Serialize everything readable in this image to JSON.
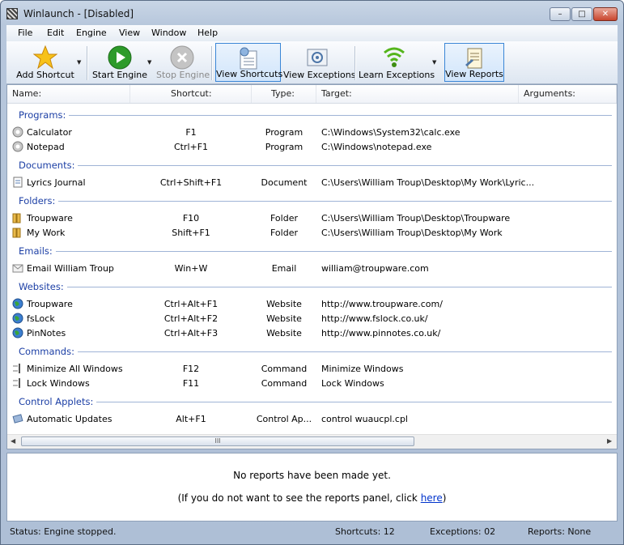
{
  "window": {
    "title": "Winlaunch - [Disabled]",
    "min_label": "–",
    "max_label": "□",
    "close_label": "✕"
  },
  "menu": [
    "File",
    "Edit",
    "Engine",
    "View",
    "Window",
    "Help"
  ],
  "toolbar": {
    "add_shortcut": "Add Shortcut",
    "start_engine": "Start Engine",
    "stop_engine": "Stop Engine",
    "view_shortcuts": "View Shortcuts",
    "view_exceptions": "View Exceptions",
    "learn_exceptions": "Learn Exceptions",
    "view_reports": "View Reports",
    "dropdown_glyph": "▼"
  },
  "columns": {
    "name": "Name:",
    "shortcut": "Shortcut:",
    "type": "Type:",
    "target": "Target:",
    "arguments": "Arguments:"
  },
  "groups": [
    {
      "name": "Programs:",
      "items": [
        {
          "icon": "calculator-icon",
          "name": "Calculator",
          "shortcut": "F1",
          "type": "Program",
          "target": "C:\\Windows\\System32\\calc.exe"
        },
        {
          "icon": "notepad-icon",
          "name": "Notepad",
          "shortcut": "Ctrl+F1",
          "type": "Program",
          "target": "C:\\Windows\\notepad.exe"
        }
      ]
    },
    {
      "name": "Documents:",
      "items": [
        {
          "icon": "document-icon",
          "name": "Lyrics Journal",
          "shortcut": "Ctrl+Shift+F1",
          "type": "Document",
          "target": "C:\\Users\\William Troup\\Desktop\\My Work\\Lyric..."
        }
      ]
    },
    {
      "name": "Folders:",
      "items": [
        {
          "icon": "folder-icon",
          "name": "Troupware",
          "shortcut": "F10",
          "type": "Folder",
          "target": "C:\\Users\\William Troup\\Desktop\\Troupware"
        },
        {
          "icon": "folder-icon",
          "name": "My Work",
          "shortcut": "Shift+F1",
          "type": "Folder",
          "target": "C:\\Users\\William Troup\\Desktop\\My Work"
        }
      ]
    },
    {
      "name": "Emails:",
      "items": [
        {
          "icon": "email-icon",
          "name": "Email William Troup",
          "shortcut": "Win+W",
          "type": "Email",
          "target": "william@troupware.com"
        }
      ]
    },
    {
      "name": "Websites:",
      "items": [
        {
          "icon": "globe-icon",
          "name": "Troupware",
          "shortcut": "Ctrl+Alt+F1",
          "type": "Website",
          "target": "http://www.troupware.com/"
        },
        {
          "icon": "globe-icon",
          "name": "fsLock",
          "shortcut": "Ctrl+Alt+F2",
          "type": "Website",
          "target": "http://www.fslock.co.uk/"
        },
        {
          "icon": "globe-icon",
          "name": "PinNotes",
          "shortcut": "Ctrl+Alt+F3",
          "type": "Website",
          "target": "http://www.pinnotes.co.uk/"
        }
      ]
    },
    {
      "name": "Commands:",
      "items": [
        {
          "icon": "command-icon",
          "name": "Minimize All Windows",
          "shortcut": "F12",
          "type": "Command",
          "target": "Minimize Windows"
        },
        {
          "icon": "command-icon",
          "name": "Lock Windows",
          "shortcut": "F11",
          "type": "Command",
          "target": "Lock Windows"
        }
      ]
    },
    {
      "name": "Control Applets:",
      "items": [
        {
          "icon": "control-applet-icon",
          "name": "Automatic Updates",
          "shortcut": "Alt+F1",
          "type": "Control Ap...",
          "target": "control wuaucpl.cpl"
        }
      ]
    }
  ],
  "scroll": {
    "thumb_grip": "III",
    "left_arrow": "◀",
    "right_arrow": "▶"
  },
  "reports": {
    "message": "No reports have been made yet.",
    "hint_prefix": "(If you do not want to see the reports panel, click ",
    "hint_link": "here",
    "hint_suffix": ")"
  },
  "status": {
    "status": "Status:  Engine stopped.",
    "shortcuts": "Shortcuts:  12",
    "exceptions": "Exceptions:  02",
    "reports": "Reports:  None"
  }
}
